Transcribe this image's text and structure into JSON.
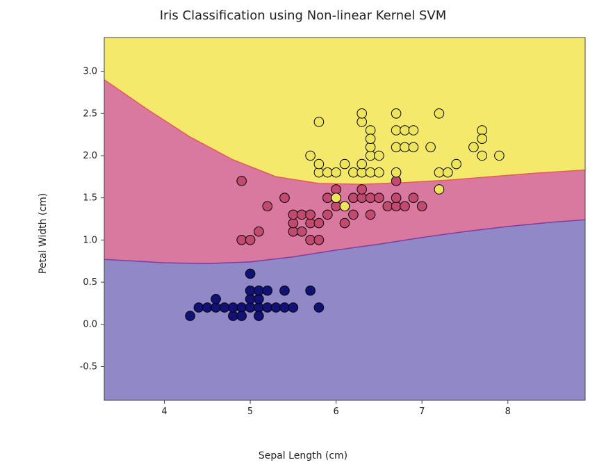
{
  "chart_data": {
    "type": "scatter",
    "title": "Iris Classification using Non-linear Kernel SVM",
    "xlabel": "Sepal Length (cm)",
    "ylabel": "Petal Width (cm)",
    "xlim": [
      3.3,
      8.9
    ],
    "ylim": [
      -0.9,
      3.4
    ],
    "x_ticks": [
      4,
      5,
      6,
      7,
      8
    ],
    "y_ticks": [
      -0.5,
      0.0,
      0.5,
      1.0,
      1.5,
      2.0,
      2.5,
      3.0
    ],
    "region_colors": {
      "class0": "#9189c7",
      "class1": "#d9799f",
      "class2": "#f4e96b"
    },
    "point_colors": {
      "class0": "#111177",
      "class1": "#c24a71",
      "class2": "#efe55a"
    },
    "boundary_lower": [
      {
        "x": 3.3,
        "y": 0.77
      },
      {
        "x": 4.0,
        "y": 0.73
      },
      {
        "x": 4.5,
        "y": 0.72
      },
      {
        "x": 5.0,
        "y": 0.74
      },
      {
        "x": 5.5,
        "y": 0.8
      },
      {
        "x": 6.0,
        "y": 0.88
      },
      {
        "x": 6.5,
        "y": 0.95
      },
      {
        "x": 7.0,
        "y": 1.03
      },
      {
        "x": 7.5,
        "y": 1.1
      },
      {
        "x": 8.0,
        "y": 1.16
      },
      {
        "x": 8.5,
        "y": 1.21
      },
      {
        "x": 8.9,
        "y": 1.24
      }
    ],
    "boundary_upper": [
      {
        "x": 3.3,
        "y": 2.9
      },
      {
        "x": 3.8,
        "y": 2.55
      },
      {
        "x": 4.3,
        "y": 2.22
      },
      {
        "x": 4.8,
        "y": 1.95
      },
      {
        "x": 5.3,
        "y": 1.75
      },
      {
        "x": 5.8,
        "y": 1.67
      },
      {
        "x": 6.3,
        "y": 1.66
      },
      {
        "x": 6.8,
        "y": 1.68
      },
      {
        "x": 7.3,
        "y": 1.71
      },
      {
        "x": 7.8,
        "y": 1.75
      },
      {
        "x": 8.3,
        "y": 1.79
      },
      {
        "x": 8.9,
        "y": 1.83
      }
    ],
    "series": [
      {
        "name": "class0",
        "points": [
          {
            "x": 4.3,
            "y": 0.1
          },
          {
            "x": 4.4,
            "y": 0.2
          },
          {
            "x": 4.5,
            "y": 0.2
          },
          {
            "x": 4.6,
            "y": 0.2
          },
          {
            "x": 4.6,
            "y": 0.3
          },
          {
            "x": 4.7,
            "y": 0.2
          },
          {
            "x": 4.8,
            "y": 0.1
          },
          {
            "x": 4.8,
            "y": 0.2
          },
          {
            "x": 4.9,
            "y": 0.2
          },
          {
            "x": 4.9,
            "y": 0.1
          },
          {
            "x": 5.0,
            "y": 0.6
          },
          {
            "x": 5.0,
            "y": 0.2
          },
          {
            "x": 5.0,
            "y": 0.3
          },
          {
            "x": 5.0,
            "y": 0.4
          },
          {
            "x": 5.1,
            "y": 0.2
          },
          {
            "x": 5.1,
            "y": 0.3
          },
          {
            "x": 5.1,
            "y": 0.4
          },
          {
            "x": 5.1,
            "y": 0.1
          },
          {
            "x": 5.2,
            "y": 0.2
          },
          {
            "x": 5.2,
            "y": 0.4
          },
          {
            "x": 5.3,
            "y": 0.2
          },
          {
            "x": 5.4,
            "y": 0.2
          },
          {
            "x": 5.4,
            "y": 0.4
          },
          {
            "x": 5.5,
            "y": 0.2
          },
          {
            "x": 5.7,
            "y": 0.4
          },
          {
            "x": 5.8,
            "y": 0.2
          }
        ]
      },
      {
        "name": "class1",
        "points": [
          {
            "x": 4.9,
            "y": 1.0
          },
          {
            "x": 4.9,
            "y": 1.7
          },
          {
            "x": 5.0,
            "y": 1.0
          },
          {
            "x": 5.1,
            "y": 1.1
          },
          {
            "x": 5.2,
            "y": 1.4
          },
          {
            "x": 5.4,
            "y": 1.5
          },
          {
            "x": 5.5,
            "y": 1.1
          },
          {
            "x": 5.5,
            "y": 1.2
          },
          {
            "x": 5.5,
            "y": 1.3
          },
          {
            "x": 5.6,
            "y": 1.3
          },
          {
            "x": 5.6,
            "y": 1.1
          },
          {
            "x": 5.7,
            "y": 1.2
          },
          {
            "x": 5.7,
            "y": 1.3
          },
          {
            "x": 5.7,
            "y": 1.0
          },
          {
            "x": 5.8,
            "y": 1.0
          },
          {
            "x": 5.8,
            "y": 1.2
          },
          {
            "x": 5.9,
            "y": 1.5
          },
          {
            "x": 5.9,
            "y": 1.3
          },
          {
            "x": 6.0,
            "y": 1.5
          },
          {
            "x": 6.0,
            "y": 1.6
          },
          {
            "x": 6.0,
            "y": 1.4
          },
          {
            "x": 6.1,
            "y": 1.4
          },
          {
            "x": 6.1,
            "y": 1.2
          },
          {
            "x": 6.2,
            "y": 1.5
          },
          {
            "x": 6.2,
            "y": 1.3
          },
          {
            "x": 6.3,
            "y": 1.5
          },
          {
            "x": 6.3,
            "y": 1.6
          },
          {
            "x": 6.4,
            "y": 1.3
          },
          {
            "x": 6.4,
            "y": 1.5
          },
          {
            "x": 6.5,
            "y": 1.5
          },
          {
            "x": 6.6,
            "y": 1.4
          },
          {
            "x": 6.7,
            "y": 1.4
          },
          {
            "x": 6.7,
            "y": 1.5
          },
          {
            "x": 6.7,
            "y": 1.7
          },
          {
            "x": 6.8,
            "y": 1.4
          },
          {
            "x": 6.9,
            "y": 1.5
          },
          {
            "x": 7.0,
            "y": 1.4
          }
        ]
      },
      {
        "name": "class2",
        "points": [
          {
            "x": 5.7,
            "y": 2.0
          },
          {
            "x": 5.8,
            "y": 2.4
          },
          {
            "x": 5.8,
            "y": 1.8
          },
          {
            "x": 5.8,
            "y": 1.9
          },
          {
            "x": 5.9,
            "y": 1.8
          },
          {
            "x": 6.0,
            "y": 1.5
          },
          {
            "x": 6.0,
            "y": 1.8
          },
          {
            "x": 6.1,
            "y": 1.4
          },
          {
            "x": 6.1,
            "y": 1.9
          },
          {
            "x": 6.2,
            "y": 1.8
          },
          {
            "x": 6.3,
            "y": 2.4
          },
          {
            "x": 6.3,
            "y": 2.5
          },
          {
            "x": 6.3,
            "y": 1.8
          },
          {
            "x": 6.3,
            "y": 1.9
          },
          {
            "x": 6.4,
            "y": 2.0
          },
          {
            "x": 6.4,
            "y": 2.1
          },
          {
            "x": 6.4,
            "y": 1.8
          },
          {
            "x": 6.4,
            "y": 2.3
          },
          {
            "x": 6.4,
            "y": 2.2
          },
          {
            "x": 6.5,
            "y": 1.8
          },
          {
            "x": 6.5,
            "y": 2.0
          },
          {
            "x": 6.7,
            "y": 2.5
          },
          {
            "x": 6.7,
            "y": 2.3
          },
          {
            "x": 6.7,
            "y": 2.1
          },
          {
            "x": 6.7,
            "y": 1.8
          },
          {
            "x": 6.8,
            "y": 2.1
          },
          {
            "x": 6.8,
            "y": 2.3
          },
          {
            "x": 6.9,
            "y": 2.3
          },
          {
            "x": 6.9,
            "y": 2.1
          },
          {
            "x": 7.1,
            "y": 2.1
          },
          {
            "x": 7.2,
            "y": 1.6
          },
          {
            "x": 7.2,
            "y": 1.8
          },
          {
            "x": 7.2,
            "y": 2.5
          },
          {
            "x": 7.3,
            "y": 1.8
          },
          {
            "x": 7.4,
            "y": 1.9
          },
          {
            "x": 7.6,
            "y": 2.1
          },
          {
            "x": 7.7,
            "y": 2.3
          },
          {
            "x": 7.7,
            "y": 2.0
          },
          {
            "x": 7.7,
            "y": 2.2
          },
          {
            "x": 7.9,
            "y": 2.0
          }
        ]
      }
    ]
  }
}
